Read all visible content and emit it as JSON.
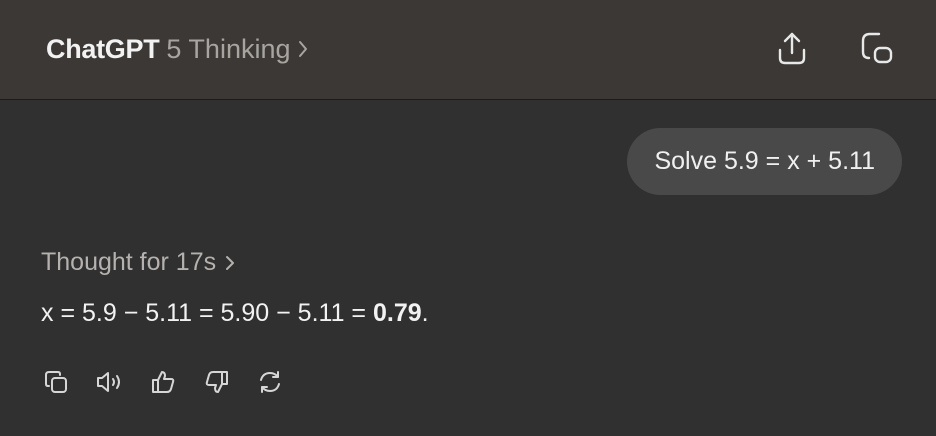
{
  "header": {
    "brand": "ChatGPT",
    "model": "5 Thinking",
    "model_chevron_icon": "chevron-right-icon",
    "share_icon": "share-icon",
    "new_chat_icon": "new-chat-icon"
  },
  "conversation": {
    "user_message": "Solve 5.9 = x + 5.11",
    "thought_label": "Thought for 17s",
    "answer_prefix": "x = 5.9 − 5.11 = 5.90 − 5.11 = ",
    "answer_result": "0.79",
    "answer_suffix": "."
  },
  "message_actions": [
    {
      "name": "copy",
      "icon": "copy-icon"
    },
    {
      "name": "read-aloud",
      "icon": "speaker-icon"
    },
    {
      "name": "good-response",
      "icon": "thumbs-up-icon"
    },
    {
      "name": "bad-response",
      "icon": "thumbs-down-icon"
    },
    {
      "name": "regenerate",
      "icon": "regenerate-icon"
    }
  ],
  "colors": {
    "background": "#303030",
    "header_background": "#3b3835",
    "user_bubble": "#4a4949",
    "primary_text": "#f2f2f2",
    "secondary_text": "#a8a5a1"
  }
}
